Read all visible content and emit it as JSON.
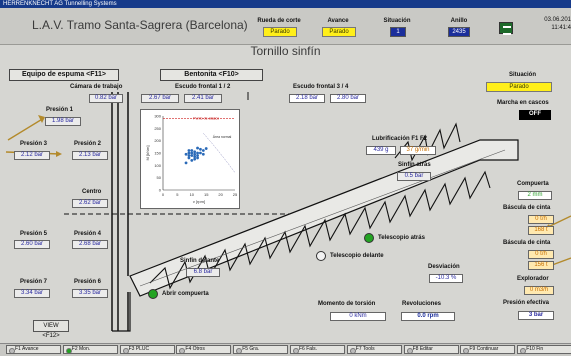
{
  "window": {
    "title": "HERRENKNECHT AG Tunnelling Systems"
  },
  "header": {
    "project": "L.A.V. Tramo Santa-Sagrera (Barcelona)",
    "rueda_label": "Rueda de corte",
    "rueda_value": "Parado",
    "avance_label": "Avance",
    "avance_value": "Parado",
    "situacion_label": "Situación",
    "situacion_value": "1",
    "anillo_label": "Anillo",
    "anillo_value": "2435",
    "date": "03.06.201",
    "time": "11:41:4"
  },
  "page_title": "Tornillo sinfín",
  "tabs": {
    "espuma": "Equipo de espuma <F11>",
    "bentonita": "Bentonita <F10>"
  },
  "camara": {
    "label": "Cámara de trabajo",
    "value": "0.82 bar"
  },
  "escudo12": {
    "label": "Escudo frontal 1 / 2",
    "value1": "2.67 bar",
    "value2": "2.41 bar"
  },
  "escudo34": {
    "label": "Escudo frontal 3 / 4",
    "value1": "2.18 bar",
    "value2": "2.80 bar"
  },
  "pressures": {
    "p1_label": "Presión 1",
    "p1_value": "1.98 bar",
    "p2_label": "Presión 2",
    "p2_value": "2.13 bar",
    "p3_label": "Presión 3",
    "p3_value": "2.12 bar",
    "centro_label": "Centro",
    "centro_value": "2.62 bar",
    "p4_label": "Presión 4",
    "p4_value": "2.68 bar",
    "p5_label": "Presión 5",
    "p5_value": "2.60 bar",
    "p6_label": "Presión 6",
    "p6_value": "3.35 bar",
    "p7_label": "Presión 7",
    "p7_value": "3.34 bar"
  },
  "chart_data": {
    "type": "scatter",
    "title": "",
    "xlabel": "v [rpm]",
    "ylabel": "M [kNm]",
    "xticks": [
      "0",
      "5",
      "10",
      "15",
      "20",
      "25"
    ],
    "yticks": [
      "0",
      "50",
      "100",
      "150",
      "200",
      "250",
      "300"
    ],
    "annotations": [
      "Punto de atasco",
      "Área normal"
    ],
    "xlim": [
      0,
      25
    ],
    "ylim": [
      0,
      300
    ],
    "points": [
      [
        8,
        145
      ],
      [
        9,
        150
      ],
      [
        10,
        140
      ],
      [
        11,
        155
      ],
      [
        10,
        160
      ],
      [
        12,
        150
      ],
      [
        9,
        130
      ],
      [
        11,
        135
      ],
      [
        13,
        165
      ],
      [
        12,
        170
      ],
      [
        10,
        120
      ],
      [
        8,
        110
      ],
      [
        14,
        160
      ],
      [
        11,
        145
      ],
      [
        12,
        140
      ],
      [
        9,
        160
      ],
      [
        13,
        150
      ],
      [
        10,
        150
      ],
      [
        11,
        125
      ],
      [
        12,
        130
      ],
      [
        15,
        168
      ],
      [
        9,
        140
      ],
      [
        14,
        145
      ]
    ]
  },
  "situacion_right": {
    "label": "Situación",
    "value": "Parado"
  },
  "marcha": {
    "label": "Marcha en cascos",
    "value": "OFF"
  },
  "lubricacion": {
    "label": "Lubrificación F1 F2",
    "value1": "439 g",
    "value2": "37 g/min"
  },
  "sinfin_atras": {
    "label": "Sinfín atrás",
    "value": "0.5 bar"
  },
  "sinfin_delante": {
    "label": "Sinfín delante",
    "value": "6.8 bar"
  },
  "compuerta_label": "Compuerta",
  "compuerta_value": "2 mm",
  "bascula1": {
    "label": "Báscula de cinta",
    "value1": "0 t/h",
    "value2": "168 t"
  },
  "bascula2": {
    "label": "Báscula de cinta",
    "value1": "0 t/h",
    "value2": "156 t"
  },
  "explorador": {
    "label": "Explorador",
    "value": "0 m3/h"
  },
  "presion_efectiva": {
    "label": "Presión efectiva",
    "value": "3 bar"
  },
  "telescopio_atras": "Telescopio atrás",
  "telescopio_delante": "Telescopio delante",
  "abrir_compuerta": "Abrir compuerta",
  "desviacion": {
    "label": "Desviación",
    "value": "-10.3 %"
  },
  "momento": {
    "label": "Momento de torsión",
    "value": "0 kNm"
  },
  "revoluciones": {
    "label": "Revoluciones",
    "value": "0.0 rpm"
  },
  "view_button": "VIEW <F12>",
  "fkeys": [
    "F1 Avance",
    "F2 Mon.",
    "F3 PLUC",
    "F4 Otros",
    "F5 Gra.",
    "F6 Fals.",
    "F7 Tools",
    "F8 Editar",
    "F9 Continuar",
    "F10 Fin"
  ],
  "colors": {
    "accent_yellow": "#ffef1a",
    "blue": "#1b2e9b",
    "green_led": "#23a323",
    "arrow": "#b38a2b"
  }
}
